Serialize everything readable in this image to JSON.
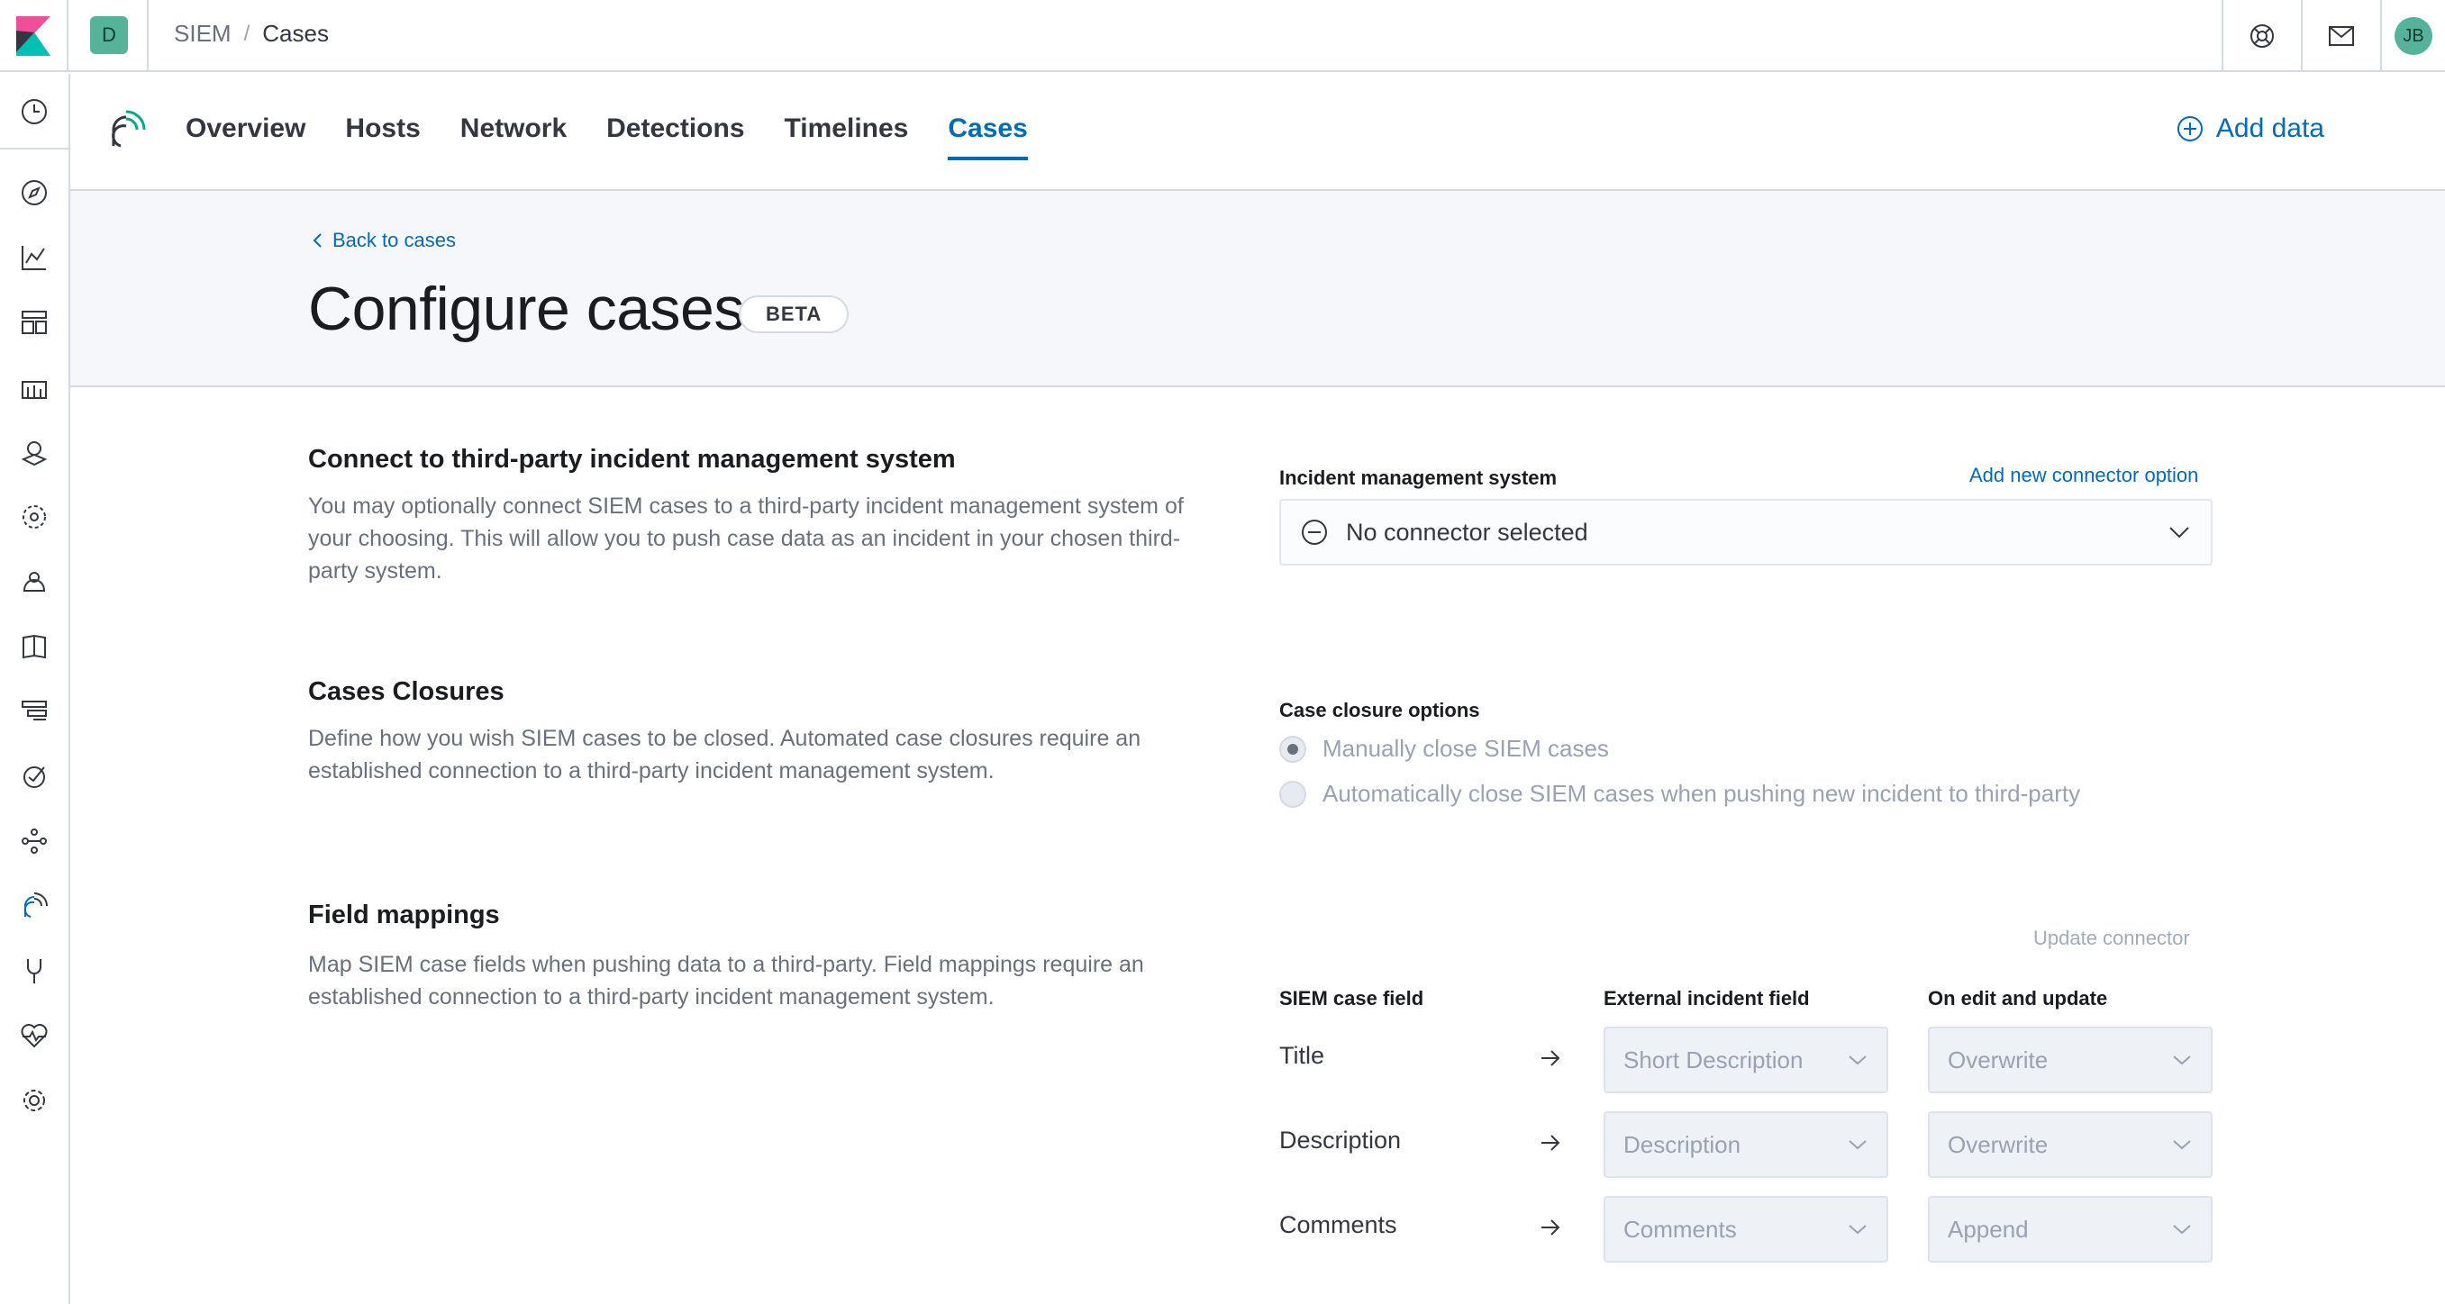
{
  "header": {
    "space_initial": "D",
    "breadcrumbs": [
      "SIEM",
      "Cases"
    ],
    "breadcrumb_separator": "/",
    "user_initials": "JB"
  },
  "app_nav": {
    "tabs": [
      {
        "label": "Overview",
        "active": false
      },
      {
        "label": "Hosts",
        "active": false
      },
      {
        "label": "Network",
        "active": false
      },
      {
        "label": "Detections",
        "active": false
      },
      {
        "label": "Timelines",
        "active": false
      },
      {
        "label": "Cases",
        "active": true
      }
    ],
    "add_data_label": "Add data"
  },
  "page": {
    "back_label": "Back to cases",
    "title": "Configure cases",
    "badge": "BETA"
  },
  "connect_section": {
    "title": "Connect to third-party incident management system",
    "description": "You may optionally connect SIEM cases to a third-party incident management system of your choosing. This will allow you to push case data as an incident in your chosen third-party system.",
    "field_label": "Incident management system",
    "add_connector_label": "Add new connector option",
    "selected_connector": "No connector selected"
  },
  "closure_section": {
    "title": "Cases Closures",
    "description": "Define how you wish SIEM cases to be closed. Automated case closures require an established connection to a third-party incident management system.",
    "field_label": "Case closure options",
    "options": [
      {
        "label": "Manually close SIEM cases",
        "checked": true
      },
      {
        "label": "Automatically close SIEM cases when pushing new incident to third-party",
        "checked": false
      }
    ]
  },
  "mapping_section": {
    "title": "Field mappings",
    "description": "Map SIEM case fields when pushing data to a third-party. Field mappings require an established connection to a third-party incident management system.",
    "update_connector_label": "Update connector",
    "columns": [
      "SIEM case field",
      "External incident field",
      "On edit and update"
    ],
    "rows": [
      {
        "field": "Title",
        "external": "Short Description",
        "action": "Overwrite"
      },
      {
        "field": "Description",
        "external": "Description",
        "action": "Overwrite"
      },
      {
        "field": "Comments",
        "external": "Comments",
        "action": "Append"
      }
    ]
  },
  "colors": {
    "accent": "#006bb8",
    "badge_green": "#54b399",
    "text": "#343741",
    "muted": "#69707d"
  }
}
